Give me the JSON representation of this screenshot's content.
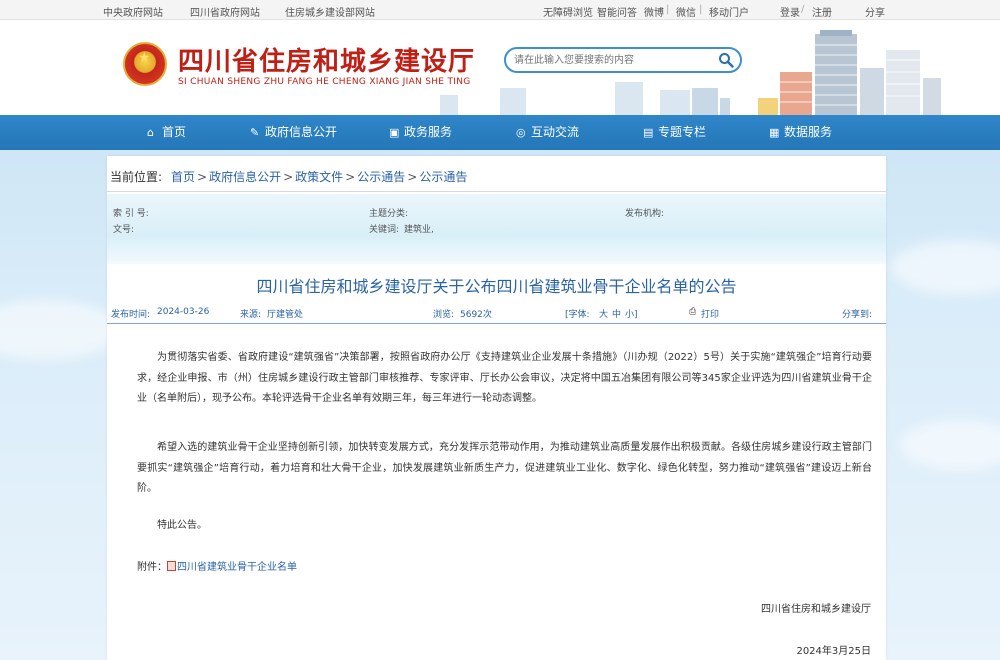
{
  "topbar": {
    "left_links": [
      "中央政府网站",
      "四川省政府网站",
      "住房城乡建设部网站"
    ],
    "right_links": [
      "无障碍浏览",
      "智能问答",
      "微博",
      "微信",
      "移动门户"
    ],
    "login": "登录",
    "register": "注册",
    "share": "分享"
  },
  "header": {
    "title": "四川省住房和城乡建设厅",
    "pinyin": "SI CHUAN SHENG ZHU FANG HE CHENG XIANG JIAN SHE TING",
    "search_placeholder": "请在此输入您要搜索的内容"
  },
  "nav": {
    "items": [
      {
        "label": "首页",
        "icon": "home-icon"
      },
      {
        "label": "政府信息公开",
        "icon": "edit-icon"
      },
      {
        "label": "政务服务",
        "icon": "service-icon"
      },
      {
        "label": "互动交流",
        "icon": "chat-icon"
      },
      {
        "label": "专题专栏",
        "icon": "column-icon"
      },
      {
        "label": "数据服务",
        "icon": "data-icon"
      }
    ]
  },
  "breadcrumb": {
    "label": "当前位置:",
    "items": [
      "首页",
      "政府信息公开",
      "政策文件",
      "公示通告",
      "公示通告"
    ]
  },
  "meta": {
    "index_label": "索 引 号:",
    "index_value": "",
    "category_label": "主题分类:",
    "category_value": "",
    "publisher_label": "发布机构:",
    "publisher_value": "",
    "docno_label": "文号:",
    "docno_value": "",
    "keywords_label": "关键词:",
    "keywords_value": "建筑业,"
  },
  "article": {
    "title": "四川省住房和城乡建设厅关于公布四川省建筑业骨干企业名单的公告",
    "publish_time_label": "发布时间:",
    "publish_time": "2024-03-26",
    "source_label": "来源:",
    "source": "厅建管处",
    "views_label": "浏览:",
    "views": "5692次",
    "font_label": "[字体:",
    "font_large": "大",
    "font_medium": "中",
    "font_small": "小]",
    "print": "打印",
    "share": "分享到:",
    "paragraphs": [
      "为贯彻落实省委、省政府建设“建筑强省”决策部署，按照省政府办公厅《支持建筑业企业发展十条措施》（川办规（2022）5号）关于实施“建筑强企”培育行动要求，经企业申报、市（州）住房城乡建设行政主管部门审核推荐、专家评审、厅长办公会审议，决定将中国五冶集团有限公司等345家企业评选为四川省建筑业骨干企业（名单附后），现予公布。本轮评选骨干企业名单有效期三年，每三年进行一轮动态调整。",
      "希望入选的建筑业骨干企业坚持创新引领，加快转变发展方式，充分发挥示范带动作用，为推动建筑业高质量发展作出积极贡献。各级住房城乡建设行政主管部门要抓实“建筑强企”培育行动，着力培育和壮大骨干企业，加快发展建筑业新质生产力，促进建筑业工业化、数字化、绿色化转型，努力推动“建筑强省”建设迈上新台阶。",
      "特此公告。"
    ],
    "attachment_label": "附件：",
    "attachment_link": "四川省建筑业骨干企业名单",
    "signature": "四川省住房和城乡建设厅",
    "date": "2024年3月25日"
  }
}
